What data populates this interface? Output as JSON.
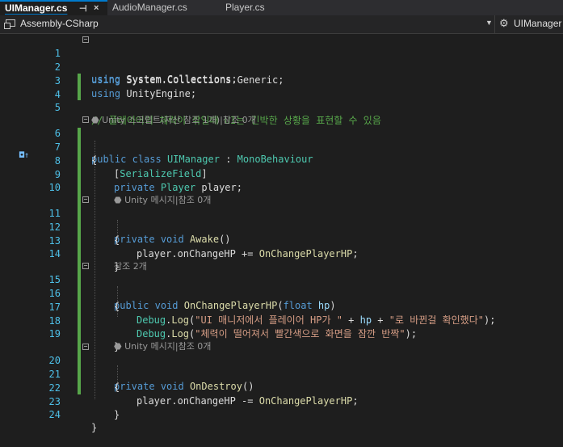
{
  "tabs": [
    {
      "label": "UIManager.cs",
      "pin": "⊣",
      "close": "×"
    },
    {
      "label": "AudioManager.cs"
    },
    {
      "label": "Player.cs"
    }
  ],
  "navbar": {
    "project": "Assembly-CSharp",
    "class": "UIManager"
  },
  "lines": {
    "l1": [
      "using",
      " System.Collections;"
    ],
    "l2": [
      "using",
      " System.Collections.Generic;"
    ],
    "l3": [
      "using",
      " UnityEngine;"
    ],
    "l5": "// 플레이어의 체력이 깎일때 UI는 긴박한 상황을 표현할 수 있음",
    "hint_class": "Unity 스크립트(자산 참조 1개)|참조 0개",
    "l6": [
      "public",
      " ",
      "class",
      " ",
      "UIManager",
      " : ",
      "MonoBehaviour"
    ],
    "l7": "{",
    "l8": [
      "[",
      "SerializeField",
      "]"
    ],
    "l9": [
      "private",
      " ",
      "Player",
      " player;"
    ],
    "hint_awake": "Unity 메시지|참조 0개",
    "l11": [
      "private",
      " ",
      "void",
      " ",
      "Awake",
      "()"
    ],
    "l12": "{",
    "l13": [
      "player.onChangeHP += ",
      "OnChangePlayerHP",
      ";"
    ],
    "l14": "}",
    "hint_onchange": "참조 2개",
    "l15": [
      "public",
      " ",
      "void",
      " ",
      "OnChangePlayerHP",
      "(",
      "float",
      " ",
      "hp",
      ")"
    ],
    "l16": "{",
    "l17": [
      "Debug",
      ".",
      "Log",
      "(",
      "\"UI 매니저에서 플레이어 HP가 \"",
      " + ",
      "hp",
      " + ",
      "\"로 바뀐걸 확인했다\"",
      ");"
    ],
    "l18": [
      "Debug",
      ".",
      "Log",
      "(",
      "\"체력이 떨어져서 빨간색으로 화면을 잠깐 반짝\"",
      ");"
    ],
    "l19": "}",
    "hint_destroy": "Unity 메시지|참조 0개",
    "l20": [
      "private",
      " ",
      "void",
      " ",
      "OnDestroy",
      "()"
    ],
    "l21": "{",
    "l22": [
      "player.onChangeHP -= ",
      "OnChangePlayerHP",
      ";"
    ],
    "l23": "}",
    "l24": "}"
  },
  "line_numbers": [
    "1",
    "2",
    "3",
    "4",
    "5",
    "6",
    "7",
    "8",
    "9",
    "10",
    "11",
    "12",
    "13",
    "14",
    "15",
    "16",
    "17",
    "18",
    "19",
    "20",
    "21",
    "22",
    "23",
    "24"
  ],
  "icons": {
    "hint_unity": "unity-icon",
    "gutter": "implementation-arrow-icon"
  }
}
